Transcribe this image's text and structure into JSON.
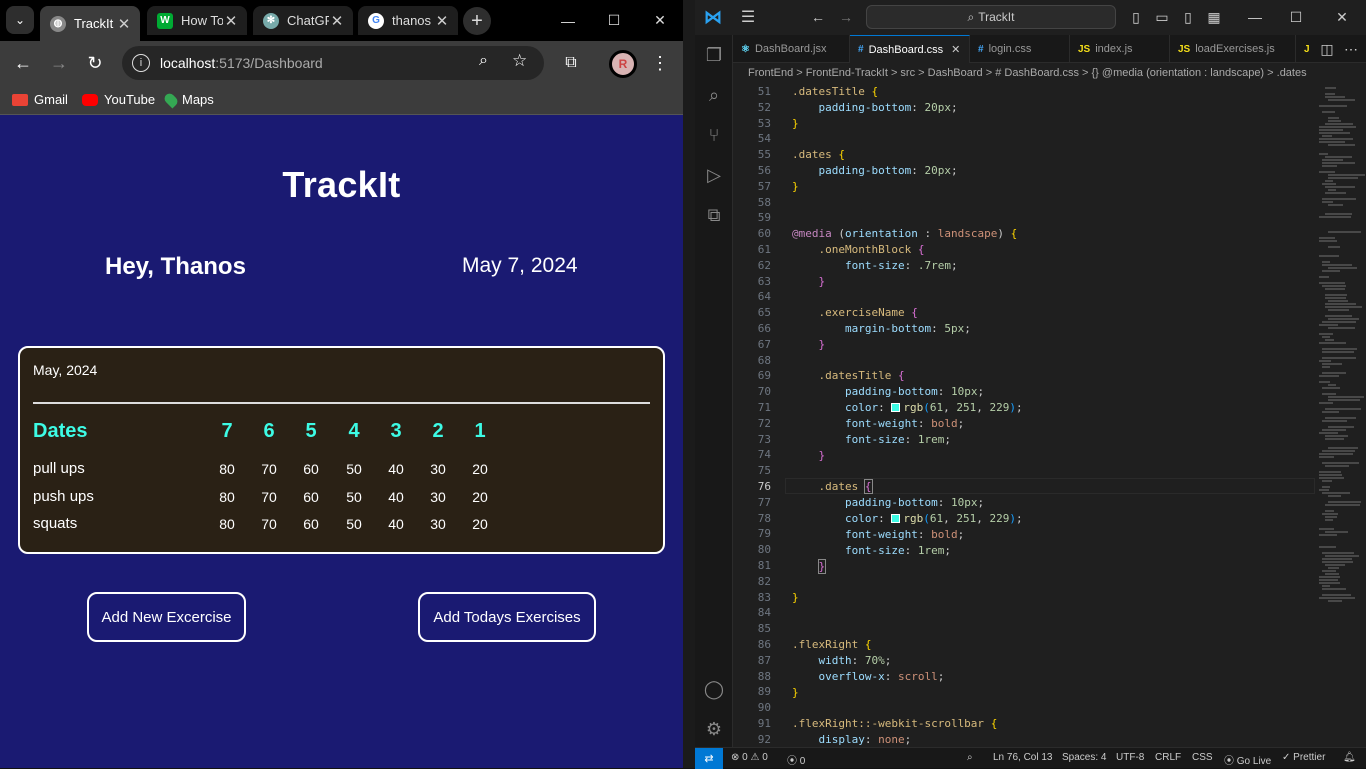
{
  "chrome": {
    "tabs": [
      {
        "title": "TrackIt",
        "active": true,
        "icon": "globe-icon"
      },
      {
        "title": "How To",
        "active": false,
        "icon": "w-logo-icon"
      },
      {
        "title": "ChatGP",
        "active": false,
        "icon": "chatgpt-icon"
      },
      {
        "title": "thanos",
        "active": false,
        "icon": "google-icon"
      }
    ],
    "url_host": "localhost",
    "url_rest": ":5173/Dashboard",
    "bookmarks": [
      "Gmail",
      "YouTube",
      "Maps"
    ],
    "avatar_letter": "R"
  },
  "app": {
    "brand": "TrackIt",
    "greeting": "Hey, Thanos",
    "today": "May 7, 2024",
    "month": "May, 2024",
    "dates_title": "Dates",
    "dates": [
      "7",
      "6",
      "5",
      "4",
      "3",
      "2",
      "1"
    ],
    "exercises": [
      {
        "name": "pull ups",
        "values": [
          "80",
          "70",
          "60",
          "50",
          "40",
          "30",
          "20"
        ]
      },
      {
        "name": "push ups",
        "values": [
          "80",
          "70",
          "60",
          "50",
          "40",
          "30",
          "20"
        ]
      },
      {
        "name": "squats",
        "values": [
          "80",
          "70",
          "60",
          "50",
          "40",
          "30",
          "20"
        ]
      }
    ],
    "btn_add_new": "Add New Excercise",
    "btn_add_today": "Add Todays Exercises",
    "colors": {
      "page_bg": "#1a1a72",
      "card_bg": "#2a2115",
      "accent": "#3dfbe5"
    }
  },
  "vscode": {
    "search": "TrackIt",
    "tabs": [
      {
        "label": "DashBoard.jsx",
        "icon": "react-icon"
      },
      {
        "label": "DashBoard.css",
        "icon": "css-icon",
        "active": true
      },
      {
        "label": "login.css",
        "icon": "css-icon"
      },
      {
        "label": "index.js",
        "icon": "js-icon"
      },
      {
        "label": "loadExercises.js",
        "icon": "js-icon"
      }
    ],
    "breadcrumb": "FrontEnd > FrontEnd-TrackIt > src > DashBoard > # DashBoard.css > {} @media (orientation : landscape) > .dates",
    "line_numbers": [
      "51",
      "52",
      "53",
      "54",
      "55",
      "56",
      "57",
      "58",
      "59",
      "60",
      "61",
      "62",
      "63",
      "64",
      "65",
      "66",
      "67",
      "68",
      "69",
      "70",
      "71",
      "72",
      "73",
      "74",
      "75",
      "76",
      "77",
      "78",
      "79",
      "80",
      "81",
      "82",
      "83",
      "84",
      "85",
      "86",
      "87",
      "88",
      "89",
      "90",
      "91",
      "92"
    ],
    "status": {
      "errors": "0",
      "warnings": "0",
      "ports": "0",
      "position": "Ln 76, Col 13",
      "spaces": "Spaces: 4",
      "encoding": "UTF-8",
      "eol": "CRLF",
      "language": "CSS",
      "golive": "Go Live",
      "prettier": "Prettier"
    }
  }
}
